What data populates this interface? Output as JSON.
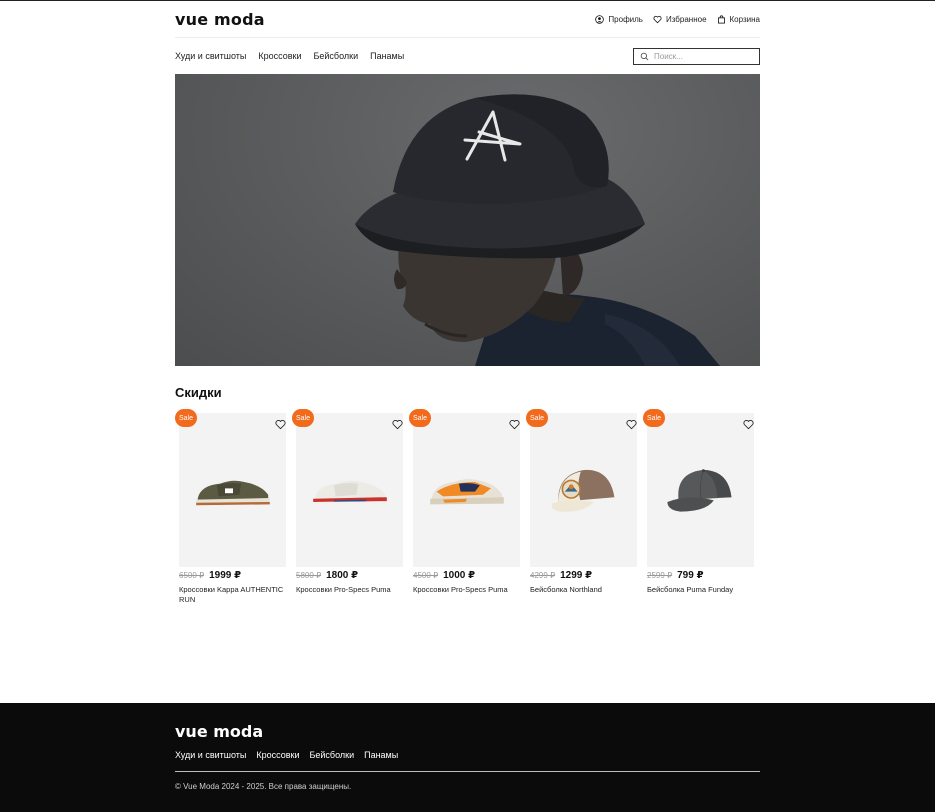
{
  "brand": {
    "logo": "vue moda"
  },
  "header": {
    "links": [
      {
        "label": "Профиль",
        "icon": "user-circle-icon"
      },
      {
        "label": "Избранное",
        "icon": "heart-icon"
      },
      {
        "label": "Корзина",
        "icon": "bag-icon"
      }
    ]
  },
  "nav": {
    "categories": [
      "Худи и свитшоты",
      "Кроссовки",
      "Бейсболки",
      "Панамы"
    ],
    "search": {
      "placeholder": "Поиск...",
      "icon": "search-icon"
    }
  },
  "hero": {
    "image": "man-in-black-bucket-hat"
  },
  "sale": {
    "title": "Скидки",
    "badge": "Sale",
    "products": [
      {
        "old_price": "6500 ₽",
        "price": "1999 ₽",
        "name": "Кроссовки Kappa AUTHENTIC RUN",
        "image": "olive-sneaker"
      },
      {
        "old_price": "5800 ₽",
        "price": "1800 ₽",
        "name": "Кроссовки Pro-Specs Puma",
        "image": "white-red-sneaker"
      },
      {
        "old_price": "4500 ₽",
        "price": "1000 ₽",
        "name": "Кроссовки Pro-Specs Puma",
        "image": "orange-navy-sneaker"
      },
      {
        "old_price": "4299 ₽",
        "price": "1299 ₽",
        "name": "Бейсболка Northland",
        "image": "trucker-cap"
      },
      {
        "old_price": "2599 ₽",
        "price": "799 ₽",
        "name": "Бейсболка Puma Funday",
        "image": "grey-cap"
      }
    ]
  },
  "footer": {
    "logo": "vue moda",
    "categories": [
      "Худи и свитшоты",
      "Кроссовки",
      "Бейсболки",
      "Панамы"
    ],
    "copyright": "© Vue Moda 2024 - 2025. Все права защищены."
  },
  "colors": {
    "accent": "#f26a1b",
    "footer_bg": "#0b0b0b",
    "text": "#111111"
  }
}
